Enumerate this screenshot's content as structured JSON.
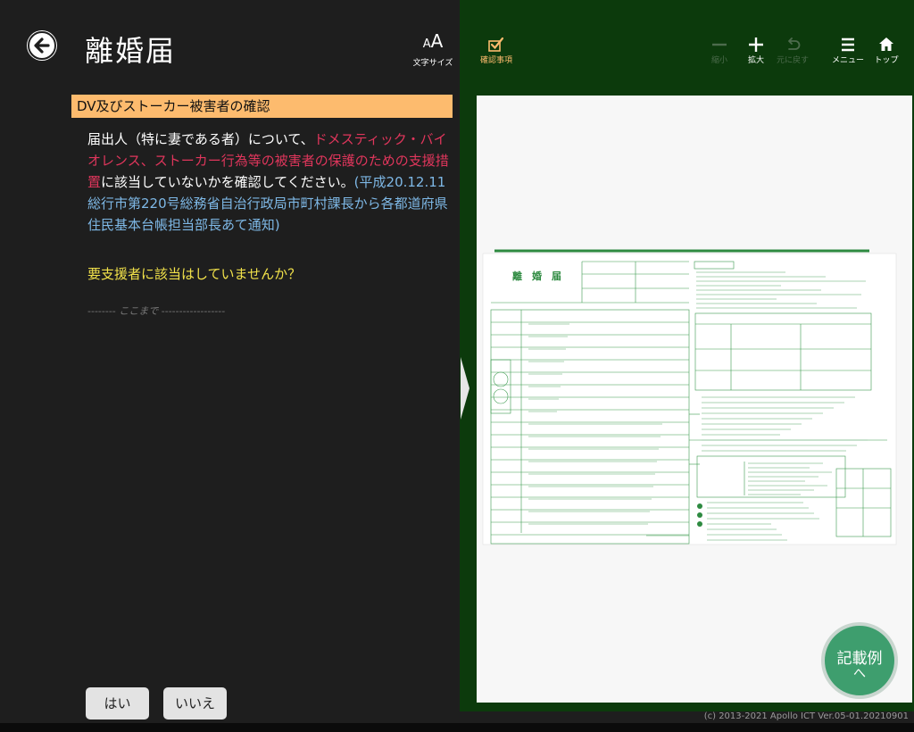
{
  "header": {
    "title": "離婚届",
    "font_size_label": "文字サイズ",
    "font_size_glyph_small": "A",
    "font_size_glyph_large": "A"
  },
  "section": {
    "title": "DV及びストーカー被害者の確認"
  },
  "description": {
    "part1": "届出人（特に妻である者）について、",
    "part2_red": "ドメスティック・バイオレンス、ストーカー行為等の被害者の保護のための支援措置",
    "part3": "に該当していないかを確認してください。",
    "part4_blue": "(平成20.12.11総行市第220号総務省自治行政局市町村課長から各都道府県住民基本台帳担当部長あて通知)"
  },
  "question": "要支援者に該当はしていませんか？",
  "end_marker": {
    "left": "--------",
    "text": "ここまで",
    "right": "------------------"
  },
  "buttons": {
    "yes": "はい",
    "no": "いいえ"
  },
  "toolbar": {
    "confirm": "確認事項",
    "zoom_out": "縮小",
    "zoom_in": "拡大",
    "undo": "元に戻す",
    "menu": "メニュー",
    "top": "トップ"
  },
  "form_preview": {
    "title": "離　婚　届"
  },
  "example_button": {
    "label": "記載例",
    "chevron": "へ"
  },
  "footer": {
    "copyright": "(c) 2013-2021 Apollo ICT  Ver.05-01.20210901"
  },
  "colors": {
    "accent_orange": "#fdbb6e",
    "highlight_red": "#e0365c",
    "note_blue": "#7eb8e6",
    "question_yellow": "#f2e24a",
    "right_bg_green": "#0c3a0c",
    "example_green": "#3e9e6e"
  },
  "icons": [
    "back-arrow-icon",
    "font-size-icon",
    "checkmark-icon",
    "minus-icon",
    "plus-icon",
    "undo-icon",
    "menu-icon",
    "home-icon",
    "chevron-right-icon"
  ]
}
